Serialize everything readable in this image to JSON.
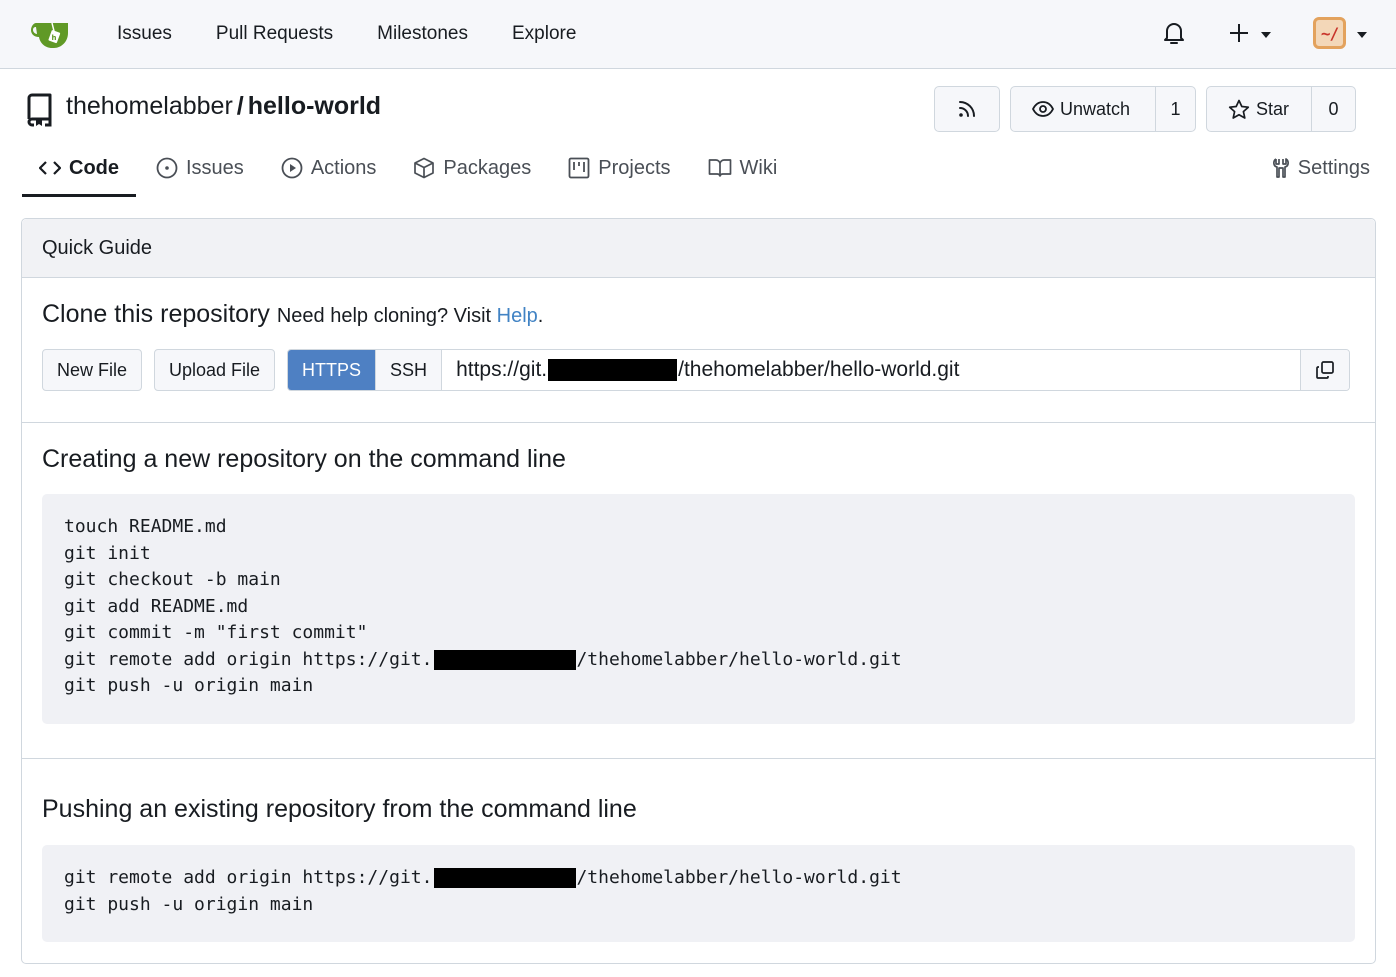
{
  "navbar": {
    "logo": "gitea-teacup-logo",
    "links": [
      "Issues",
      "Pull Requests",
      "Milestones",
      "Explore"
    ],
    "icons": {
      "notifications": "bell-icon",
      "create": "plus-icon",
      "avatar_text": "~/"
    }
  },
  "repo": {
    "owner": "thehomelabber",
    "separator": "/",
    "name": "hello-world",
    "rss_icon": "rss-icon",
    "watch_label": "Unwatch",
    "watch_count": "1",
    "star_label": "Star",
    "star_count": "0"
  },
  "tabs": [
    {
      "label": "Code",
      "icon": "code-icon",
      "active": true
    },
    {
      "label": "Issues",
      "icon": "issue-opened-icon"
    },
    {
      "label": "Actions",
      "icon": "play-icon"
    },
    {
      "label": "Packages",
      "icon": "package-icon"
    },
    {
      "label": "Projects",
      "icon": "project-icon"
    },
    {
      "label": "Wiki",
      "icon": "book-icon"
    }
  ],
  "settings_tab": {
    "label": "Settings",
    "icon": "tools-icon"
  },
  "quick_guide": {
    "title": "Quick Guide",
    "clone": {
      "title": "Clone this repository",
      "help_prefix": "Need help cloning? Visit ",
      "help_link": "Help",
      "help_suffix": ".",
      "new_file": "New File",
      "upload_file": "Upload File",
      "https": "HTTPS",
      "ssh": "SSH",
      "url_prefix": "https://git.",
      "url_suffix": "/thehomelabber/hello-world.git",
      "copy_icon": "copy-icon"
    },
    "new_repo": {
      "title": "Creating a new repository on the command line",
      "lines": [
        "touch README.md",
        "git init",
        "git checkout -b main",
        "git add README.md",
        "git commit -m \"first commit\""
      ],
      "remote_prefix": "git remote add origin https://git.",
      "remote_suffix": "/thehomelabber/hello-world.git",
      "push": "git push -u origin main"
    },
    "existing_repo": {
      "title": "Pushing an existing repository from the command line",
      "remote_prefix": "git remote add origin https://git.",
      "remote_suffix": "/thehomelabber/hello-world.git",
      "push": "git push -u origin main"
    }
  }
}
